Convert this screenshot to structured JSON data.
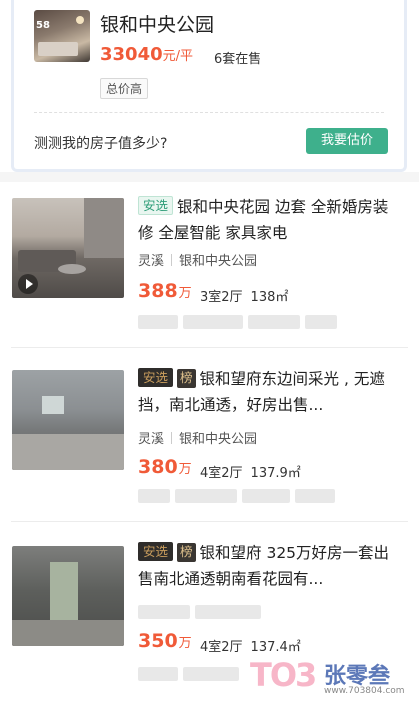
{
  "community": {
    "thumb_count": "58",
    "name": "银和中央公园",
    "price": "33040",
    "price_unit": "元/平",
    "on_sale": "6套在售",
    "tag": "总价高",
    "estimate_question": "测测我的房子值多少?",
    "estimate_button": "我要估价"
  },
  "listings": [
    {
      "badges": [
        "安选"
      ],
      "title": "银和中央花园 边套 全新婚房装修 全屋智能 家具家电",
      "district": "灵溪",
      "community": "银和中央公园",
      "price": "388",
      "price_unit": "万",
      "layout": "3室2厅",
      "area": "138㎡",
      "has_video": true
    },
    {
      "badges": [
        "安选",
        "榜"
      ],
      "title": "银和望府东边间采光 , 无遮挡，南北通透，好房出售...",
      "district": "灵溪",
      "community": "银和中央公园",
      "price": "380",
      "price_unit": "万",
      "layout": "4室2厅",
      "area": "137.9㎡",
      "has_video": false
    },
    {
      "badges": [
        "安选",
        "榜"
      ],
      "title": "银和望府 325万好房一套出售南北通透朝南看花园有...",
      "district": "",
      "community": "",
      "price": "350",
      "price_unit": "万",
      "layout": "4室2厅",
      "area": "137.4㎡",
      "has_video": false
    }
  ],
  "watermark": {
    "logo": "TO3",
    "name": "张零叁",
    "url": "www.703804.com"
  },
  "colors": {
    "price": "#f05a38",
    "estimate_button": "#3eb08c",
    "badge_green": "#2e9d78"
  }
}
